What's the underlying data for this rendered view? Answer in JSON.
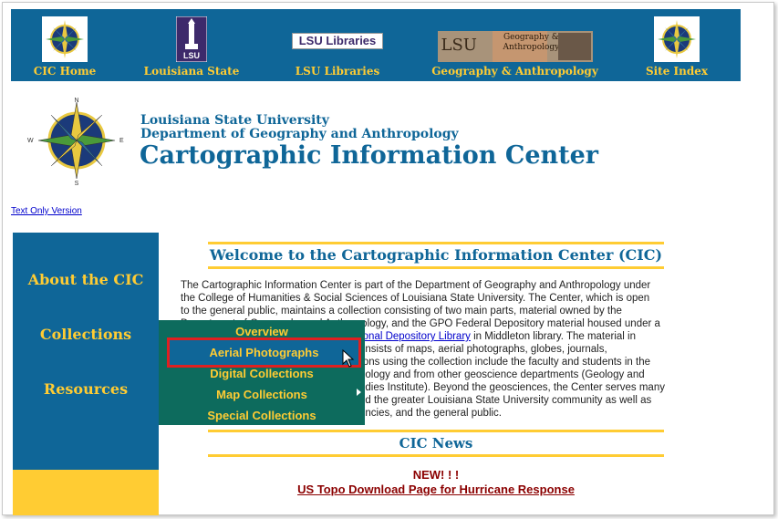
{
  "nav": {
    "items": [
      {
        "label": "CIC Home",
        "icon": "compass-rose-icon"
      },
      {
        "label": "Louisiana State",
        "icon": "lsu-tower-icon"
      },
      {
        "label": "LSU Libraries",
        "icon": "lsu-libraries-logo"
      },
      {
        "label": "Geography & Anthropology",
        "icon": "geography-anthropology-banner"
      },
      {
        "label": "Site Index",
        "icon": "compass-rose-icon"
      }
    ],
    "libraries_logo_text": "LSU Libraries",
    "lsu_tower_text": "LSU",
    "geo_banner_lsu": "LSU",
    "geo_banner_text1": "Geography &",
    "geo_banner_text2": "Anthropology"
  },
  "header": {
    "university": "Louisiana State University",
    "department": "Department of Geography and Anthropology",
    "title": "Cartographic Information Center",
    "compass_n": "N",
    "compass_s": "S",
    "compass_e": "E",
    "compass_w": "W"
  },
  "text_only_link": "Text Only Version",
  "sidebar": {
    "items": [
      "About the CIC",
      "Collections",
      "Resources"
    ]
  },
  "main": {
    "welcome_heading": "Welcome to the Cartographic Information Center (CIC)",
    "p_line1": "The Cartographic Information Center is part of the Department of Geography and Anthropology under",
    "p_line2": "the College of Humanities & Social Sciences of Louisiana State University.  The Center, which is open",
    "p_line3": "to the general public, maintains a collection consisting of two main parts, material owned by the",
    "p_line4a": "Department of Geography and Anthropology, and the GPO Federal Depository material housed under a",
    "p_line5_link": "Regional Depository Library",
    "p_line5_rest": " in Middleton library. The material in",
    "p_line6": "onsists of maps, aerial photographs, globes, journals,",
    "p_line7": "rons using the collection include the faculty and students in the",
    "p_line8": "pology and from other geoscience departments (Geology and",
    "p_line9": "udies Institute). Beyond the geosciences, the Center serves many",
    "p_line10": "nd the greater Louisiana State University community as well as",
    "p_line11": "encies, and the general public.",
    "news_heading": "CIC News",
    "news_new": "NEW! ! !",
    "news_link": "US Topo Download Page for Hurricane Response"
  },
  "dropdown": {
    "items": [
      "Overview",
      "Aerial Photographs",
      "Digital Collections",
      "Map Collections",
      "Special Collections"
    ],
    "selected": "Aerial Photographs",
    "highlight_color": "#e02020"
  },
  "colors": {
    "brand_blue": "#0f6698",
    "gold": "#ffcc33",
    "menu_teal": "#0d6b5d",
    "news_red": "#8b0000"
  }
}
